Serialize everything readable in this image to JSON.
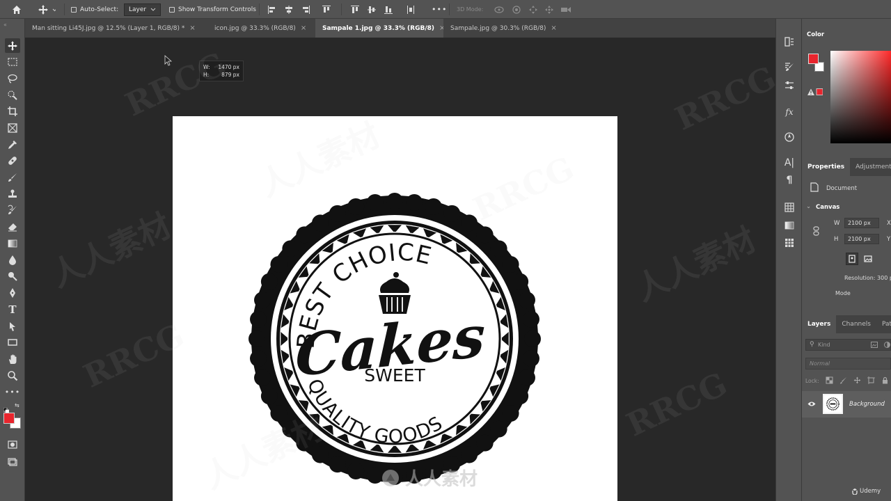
{
  "options_bar": {
    "auto_select_label": "Auto-Select:",
    "layer_dropdown": "Layer",
    "transform_controls_label": "Show Transform Controls",
    "more_label": "•••",
    "mode_3d_label": "3D Mode:"
  },
  "tabs": [
    {
      "label": "Man sitting Li45J.jpg @ 12.5% (Layer 1, RGB/8) *",
      "active": false
    },
    {
      "label": "icon.jpg @ 33.3% (RGB/8)",
      "active": false
    },
    {
      "label": "Sampale 1.jpg @ 33.3% (RGB/8)",
      "active": true
    },
    {
      "label": "Sampale.jpg @ 30.3% (RGB/8)",
      "active": false
    }
  ],
  "tab_close": "×",
  "measure_tooltip": {
    "w_label": "W:",
    "w_value": "1470 px",
    "h_label": "H:",
    "h_value": "879 px"
  },
  "logo": {
    "top_arc": "BEST CHOICE",
    "script": "Cakes",
    "sub": "SWEET",
    "bottom_arc": "QUALITY GOODS"
  },
  "watermarks": [
    "RRCG",
    "人人素材"
  ],
  "colors": {
    "foreground": "#e8252d",
    "background": "#ffffff",
    "ui_bg": "#535353",
    "canvas_bg": "#282828"
  },
  "color_panel": {
    "title": "Color"
  },
  "properties_panel": {
    "tabs": [
      "Properties",
      "Adjustments"
    ],
    "document_label": "Document",
    "canvas_label": "Canvas",
    "w_label": "W",
    "w_value": "2100 px",
    "x_label": "X",
    "h_label": "H",
    "h_value": "2100 px",
    "y_label": "Y",
    "resolution_label": "Resolution: 300 p",
    "mode_label": "Mode"
  },
  "layers_panel": {
    "tabs": [
      "Layers",
      "Channels",
      "Paths"
    ],
    "kind_placeholder": "Kind",
    "blend_mode": "Normal",
    "lock_label": "Lock:",
    "layer_name": "Background"
  },
  "footer_brand": "Udemy"
}
